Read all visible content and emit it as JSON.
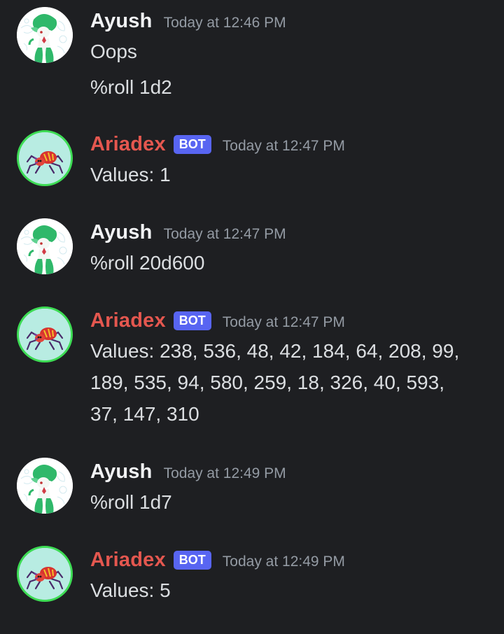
{
  "messages": [
    {
      "author": "Ayush",
      "is_bot": false,
      "timestamp": "Today at 12:46 PM",
      "lines": [
        "Oops",
        "%roll 1d2"
      ]
    },
    {
      "author": "Ariadex",
      "is_bot": true,
      "bot_tag": "BOT",
      "timestamp": "Today at 12:47 PM",
      "lines": [
        "Values: 1"
      ]
    },
    {
      "author": "Ayush",
      "is_bot": false,
      "timestamp": "Today at 12:47 PM",
      "lines": [
        "%roll 20d600"
      ]
    },
    {
      "author": "Ariadex",
      "is_bot": true,
      "bot_tag": "BOT",
      "timestamp": "Today at 12:47 PM",
      "lines": [
        "Values: 238, 536, 48, 42, 184, 64, 208, 99,",
        "189, 535, 94, 580, 259, 18, 326, 40, 593,",
        "37, 147, 310"
      ]
    },
    {
      "author": "Ayush",
      "is_bot": false,
      "timestamp": "Today at 12:49 PM",
      "lines": [
        "%roll 1d7"
      ]
    },
    {
      "author": "Ariadex",
      "is_bot": true,
      "bot_tag": "BOT",
      "timestamp": "Today at 12:49 PM",
      "lines": [
        "Values: 5"
      ]
    }
  ],
  "icons": {
    "user_avatar": "gardevoir-avatar-icon",
    "bot_avatar": "ariados-avatar-icon"
  },
  "colors": {
    "background": "#1e1f22",
    "user_name": "#f2f3f5",
    "bot_name": "#e4574f",
    "bot_tag": "#5865f2",
    "timestamp": "#949ba4",
    "message_text": "#dbdee1",
    "bot_avatar_ring": "#3ddc54"
  }
}
